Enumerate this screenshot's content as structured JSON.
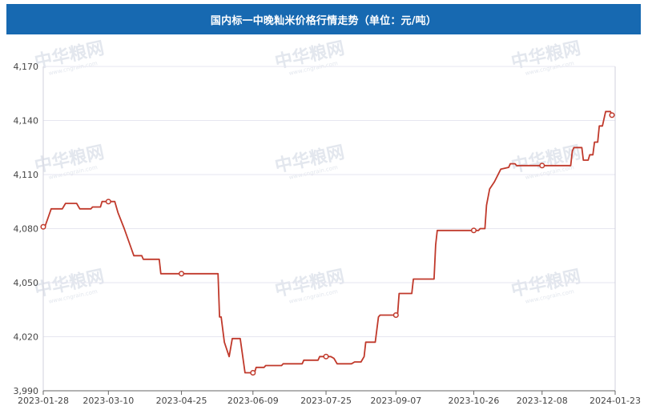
{
  "header": {
    "title": "国内标一中晚籼米价格行情走势（单位：元/吨）"
  },
  "watermark": {
    "text": "中华粮网",
    "sub": "www.cngrain.com"
  },
  "colors": {
    "header_bg": "#1769b1",
    "line": "#c0392b",
    "grid": "#e6e6f0"
  },
  "chart_data": {
    "type": "line",
    "title": "国内标一中晚籼米价格行情走势（单位：元/吨）",
    "xlabel": "",
    "ylabel": "",
    "ylim": [
      3990,
      4170
    ],
    "yticks": [
      3990,
      4020,
      4050,
      4080,
      4110,
      4140,
      4170
    ],
    "y_tick_labels": [
      "3,990",
      "4,020",
      "4,050",
      "4,080",
      "4,110",
      "4,140",
      "4,170"
    ],
    "xlim": [
      "2023-01-28",
      "2024-01-23"
    ],
    "x_ticks": [
      "2023-01-28",
      "2023-03-10",
      "2023-04-25",
      "2023-06-09",
      "2023-07-25",
      "2023-09-07",
      "2023-10-26",
      "2023-12-08",
      "2024-01-23"
    ],
    "grid": "horizontal",
    "legend": "none",
    "series": [
      {
        "points": [
          [
            "2023-01-28",
            4081
          ],
          [
            "2023-01-29",
            4081
          ],
          [
            "2023-01-31",
            4086
          ],
          [
            "2023-02-02",
            4091
          ],
          [
            "2023-02-09",
            4091
          ],
          [
            "2023-02-11",
            4094
          ],
          [
            "2023-02-18",
            4094
          ],
          [
            "2023-02-20",
            4091
          ],
          [
            "2023-02-27",
            4091
          ],
          [
            "2023-02-28",
            4092
          ],
          [
            "2023-03-05",
            4092
          ],
          [
            "2023-03-06",
            4095
          ],
          [
            "2023-03-14",
            4095
          ],
          [
            "2023-03-16",
            4089
          ],
          [
            "2023-03-20",
            4080
          ],
          [
            "2023-03-24",
            4070
          ],
          [
            "2023-03-26",
            4065
          ],
          [
            "2023-03-31",
            4065
          ],
          [
            "2023-04-01",
            4063
          ],
          [
            "2023-04-11",
            4063
          ],
          [
            "2023-04-12",
            4055
          ],
          [
            "2023-04-25",
            4055
          ],
          [
            "2023-05-18",
            4055
          ],
          [
            "2023-05-19",
            4031
          ],
          [
            "2023-05-20",
            4031
          ],
          [
            "2023-05-22",
            4017
          ],
          [
            "2023-05-25",
            4009
          ],
          [
            "2023-05-27",
            4019
          ],
          [
            "2023-06-01",
            4019
          ],
          [
            "2023-06-04",
            4000
          ],
          [
            "2023-06-10",
            4000
          ],
          [
            "2023-06-11",
            4003
          ],
          [
            "2023-06-16",
            4003
          ],
          [
            "2023-06-17",
            4004
          ],
          [
            "2023-06-27",
            4004
          ],
          [
            "2023-06-28",
            4005
          ],
          [
            "2023-07-10",
            4005
          ],
          [
            "2023-07-11",
            4007
          ],
          [
            "2023-07-20",
            4007
          ],
          [
            "2023-07-21",
            4009
          ],
          [
            "2023-07-28",
            4009
          ],
          [
            "2023-07-30",
            4008
          ],
          [
            "2023-08-01",
            4005
          ],
          [
            "2023-08-10",
            4005
          ],
          [
            "2023-08-12",
            4006
          ],
          [
            "2023-08-16",
            4006
          ],
          [
            "2023-08-18",
            4009
          ],
          [
            "2023-08-19",
            4017
          ],
          [
            "2023-08-25",
            4017
          ],
          [
            "2023-08-27",
            4031
          ],
          [
            "2023-08-28",
            4032
          ],
          [
            "2023-09-08",
            4032
          ],
          [
            "2023-09-09",
            4044
          ],
          [
            "2023-09-17",
            4044
          ],
          [
            "2023-09-18",
            4052
          ],
          [
            "2023-10-01",
            4052
          ],
          [
            "2023-10-02",
            4071
          ],
          [
            "2023-10-03",
            4079
          ],
          [
            "2023-10-29",
            4079
          ],
          [
            "2023-10-30",
            4080
          ],
          [
            "2023-11-02",
            4080
          ],
          [
            "2023-11-03",
            4093
          ],
          [
            "2023-11-05",
            4102
          ],
          [
            "2023-11-08",
            4106
          ],
          [
            "2023-11-12",
            4113
          ],
          [
            "2023-11-17",
            4114
          ],
          [
            "2023-11-18",
            4116
          ],
          [
            "2023-11-21",
            4116
          ],
          [
            "2023-11-22",
            4115
          ],
          [
            "2023-12-08",
            4115
          ],
          [
            "2023-12-26",
            4115
          ],
          [
            "2023-12-27",
            4123
          ],
          [
            "2023-12-28",
            4125
          ],
          [
            "2024-01-02",
            4125
          ],
          [
            "2024-01-03",
            4118
          ],
          [
            "2024-01-06",
            4118
          ],
          [
            "2024-01-07",
            4121
          ],
          [
            "2024-01-09",
            4121
          ],
          [
            "2024-01-10",
            4128
          ],
          [
            "2024-01-12",
            4128
          ],
          [
            "2024-01-13",
            4137
          ],
          [
            "2024-01-15",
            4137
          ],
          [
            "2024-01-17",
            4145
          ],
          [
            "2024-01-20",
            4145
          ],
          [
            "2024-01-21",
            4143
          ]
        ],
        "markers": [
          [
            "2023-01-28",
            4081
          ],
          [
            "2023-03-10",
            4095
          ],
          [
            "2023-04-25",
            4055
          ],
          [
            "2023-06-09",
            4000
          ],
          [
            "2023-07-25",
            4009
          ],
          [
            "2023-09-07",
            4032
          ],
          [
            "2023-10-26",
            4079
          ],
          [
            "2023-12-08",
            4115
          ],
          [
            "2024-01-21",
            4143
          ]
        ]
      }
    ]
  }
}
